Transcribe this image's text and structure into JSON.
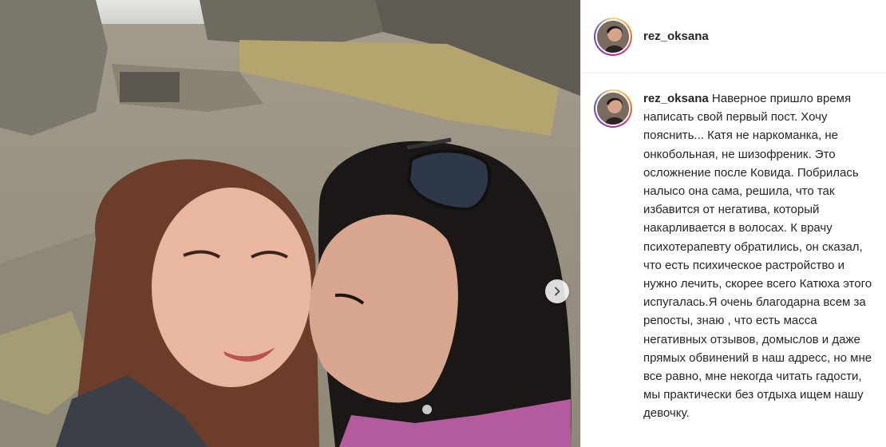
{
  "post": {
    "username": "rez_oksana",
    "caption_username": "rez_oksana",
    "caption_text": "Наверное пришло время написать свой первый пост. Хочу пояснить... Катя не наркоманка, не онкобольная, не шизофреник. Это осложнение после Ковида. Побрилась налысо она сама, решила, что так избавится от негатива, который накарливается в волосах. К врачу психотерапевту обратились, он сказал, что есть психическое растройство и нужно лечить, скорее всего Катюха этого испугалась.Я очень благодарна всем за репосты, знаю , что есть масса негативных отзывов, домыслов и даже прямых обвинений в наш адресс, но мне все равно, мне некогда читать гадости, мы практически без отдыха ищем нашу девочку."
  },
  "icons": {
    "next": "chevron-right-icon",
    "avatar": "avatar-icon"
  },
  "colors": {
    "text": "#262626",
    "border": "#efefef",
    "story_ring": [
      "#feda75",
      "#fa7e1e",
      "#d62976",
      "#962fbf",
      "#4f5bd5"
    ]
  }
}
